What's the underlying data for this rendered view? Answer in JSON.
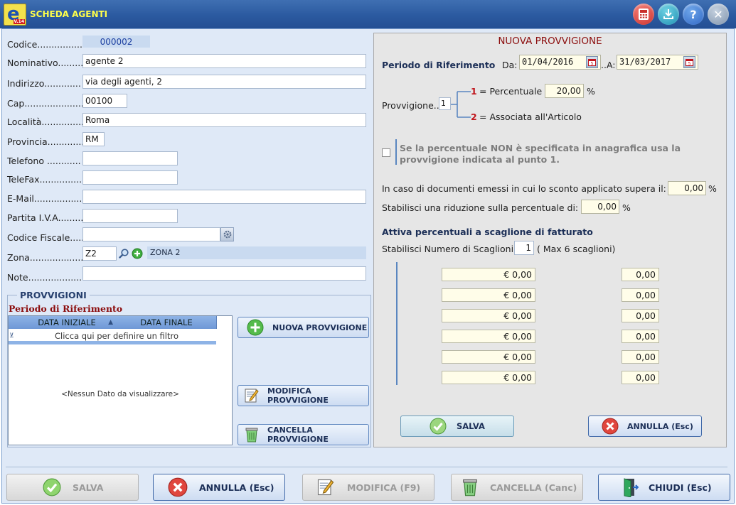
{
  "window": {
    "title": "SCHEDA AGENTI",
    "logo_letter": "e",
    "logo_version": "V.14"
  },
  "titlebar_icons": [
    "calculator-icon",
    "download-icon",
    "help-icon",
    "close-icon"
  ],
  "form": {
    "codice": {
      "label": "Codice................",
      "value": "000002"
    },
    "nominativo": {
      "label": "Nominativo.........",
      "value": "agente 2"
    },
    "indirizzo": {
      "label": "Indirizzo.............",
      "value": "via degli agenti, 2"
    },
    "cap": {
      "label": "Cap......................",
      "value": "00100"
    },
    "localita": {
      "label": "Località...............",
      "value": "Roma"
    },
    "provincia": {
      "label": "Provincia.............",
      "value": "RM"
    },
    "telefono": {
      "label": "Telefono ............",
      "value": ""
    },
    "telefax": {
      "label": "TeleFax................",
      "value": ""
    },
    "email": {
      "label": "E-Mail....................",
      "value": ""
    },
    "piva": {
      "label": "Partita I.V.A.........",
      "value": ""
    },
    "cf": {
      "label": "Codice Fiscale.......",
      "value": ""
    },
    "zona": {
      "label": "Zona....................",
      "value": "Z2",
      "desc": "ZONA 2"
    },
    "note": {
      "label": "Note.......................",
      "value": ""
    }
  },
  "provvigioni": {
    "group_title": "PROVVIGIONI",
    "period_title": "Periodo di Riferimento",
    "columns": [
      "DATA INIZIALE",
      "DATA FINALE"
    ],
    "filter_hint": "Clicca qui per definire un filtro",
    "empty_text": "<Nessun Dato da visualizzare>",
    "buttons": {
      "nuova": "NUOVA PROVVIGIONE",
      "modifica": "MODIFICA PROVVIGIONE",
      "cancella": "CANCELLA PROVVIGIONE"
    }
  },
  "nuova": {
    "title": "NUOVA PROVVIGIONE",
    "periodo_label": "Periodo di Riferimento",
    "da_label": "Da:",
    "da_value": "01/04/2016",
    "a_label": "..A:",
    "a_value": "31/03/2017",
    "provv_label": "Provvigione..",
    "provv_value": "1",
    "opt1_num": "1",
    "opt1_text": "= Percentuale",
    "perc_value": "20,00",
    "perc_unit": "%",
    "opt2_num": "2",
    "opt2_text": "= Associata all'Articolo",
    "checkbox_text_1": "Se la percentuale NON è specificata in anagrafica usa la",
    "checkbox_text_2": "provvigione indicata al punto 1.",
    "sconto_label": "In caso di documenti emessi in cui lo sconto applicato supera il:",
    "sconto_value": "0,00",
    "riduzione_label": "Stabilisci una riduzione sulla percentuale di:",
    "riduzione_value": "0,00",
    "unit": "%",
    "scaglioni_title": "Attiva percentuali a scaglione di fatturato",
    "num_scaglioni_label": "Stabilisci Numero di Scaglioni.",
    "num_scaglioni_value": "1",
    "num_scaglioni_note": "( Max 6 scaglioni)",
    "rows": [
      {
        "amount": "€ 0,00",
        "perc": "0,00"
      },
      {
        "amount": "€ 0,00",
        "perc": "0,00"
      },
      {
        "amount": "€ 0,00",
        "perc": "0,00"
      },
      {
        "amount": "€ 0,00",
        "perc": "0,00"
      },
      {
        "amount": "€ 0,00",
        "perc": "0,00"
      },
      {
        "amount": "€ 0,00",
        "perc": "0,00"
      }
    ],
    "salva": "SALVA",
    "annulla": "ANNULLA (Esc)"
  },
  "bottom": {
    "salva": "SALVA",
    "annulla": "ANNULLA (Esc)",
    "modifica": "MODIFICA  (F9)",
    "cancella": "CANCELLA  (Canc)",
    "chiudi": "CHIUDI  (Esc)"
  },
  "colors": {
    "titlebar": "#2b5aa0",
    "title_text": "#ffff4a",
    "panel": "#dfe9f7",
    "right_panel": "#e6e6e6",
    "accent_red": "#c0161d",
    "dark_red": "#8b0c0c"
  }
}
